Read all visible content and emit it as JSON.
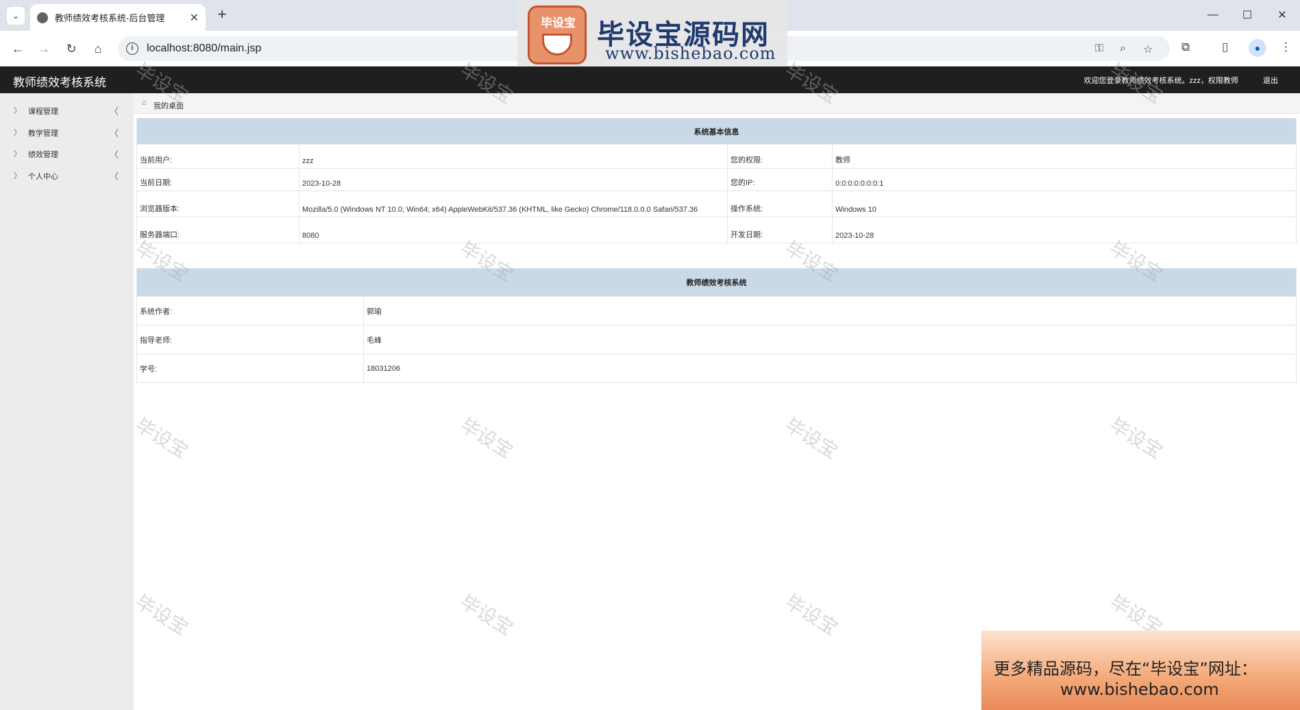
{
  "browser": {
    "tab_title": "教师绩效考核系统-后台管理",
    "url": "localhost:8080/main.jsp"
  },
  "watermark": {
    "logo_badge": "毕设宝",
    "logo_title": "毕设宝源码网",
    "logo_url": "www.bishebao.com",
    "tile_text": "毕设宝",
    "ad_line1": "更多精品源码，尽在“毕设宝”网址：",
    "ad_line2": "www.bishebao.com"
  },
  "header": {
    "title": "教师绩效考核系统",
    "welcome": "欢迎您登录教师绩效考核系统。zzz，权限教师",
    "logout": "退出"
  },
  "sidebar": {
    "items": [
      {
        "label": "课程管理"
      },
      {
        "label": "教学管理"
      },
      {
        "label": "绩效管理"
      },
      {
        "label": "个人中心"
      }
    ]
  },
  "breadcrumb": {
    "label": "我的桌面"
  },
  "system_info": {
    "heading": "系统基本信息",
    "rows": [
      {
        "k1": "当前用户:",
        "v1": "zzz",
        "k2": "您的权限:",
        "v2": "教师"
      },
      {
        "k1": "当前日期:",
        "v1": "2023-10-28",
        "k2": "您的IP:",
        "v2": "0:0:0:0:0:0:0:1"
      },
      {
        "k1": "浏览器版本:",
        "v1": "Mozilla/5.0 (Windows NT 10.0; Win64; x64) AppleWebKit/537.36 (KHTML, like Gecko) Chrome/118.0.0.0 Safari/537.36",
        "k2": "操作系统:",
        "v2": "Windows 10"
      },
      {
        "k1": "服务器端口:",
        "v1": "8080",
        "k2": "开发日期:",
        "v2": "2023-10-28"
      }
    ]
  },
  "about": {
    "heading": "教师绩效考核系统",
    "rows": [
      {
        "k": "系统作者:",
        "v": "郭瑜"
      },
      {
        "k": "指导老师:",
        "v": "毛峰"
      },
      {
        "k": "学号:",
        "v": "18031206"
      }
    ]
  }
}
